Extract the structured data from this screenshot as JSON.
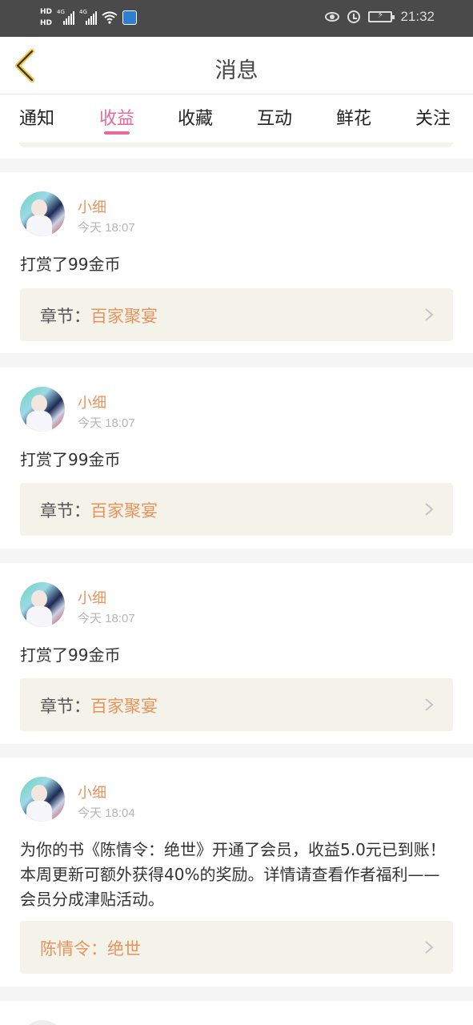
{
  "status_bar": {
    "left_hd1": "HD",
    "left_hd2": "HD",
    "net1": "4G",
    "net2": "4G",
    "time": "21:32",
    "icons": [
      "hd-icon",
      "signal-icon",
      "wifi-icon",
      "app-icon",
      "eye-icon",
      "alarm-icon",
      "battery-icon"
    ]
  },
  "header": {
    "title": "消息",
    "back_icon": "back-chevron-icon"
  },
  "tabs": [
    {
      "label": "通知"
    },
    {
      "label": "收益",
      "active": true
    },
    {
      "label": "收藏"
    },
    {
      "label": "互动"
    },
    {
      "label": "鲜花"
    },
    {
      "label": "关注"
    }
  ],
  "messages": [
    {
      "user": "小细",
      "time": "今天 18:07",
      "text": "打赏了99金币",
      "link_label": "章节：",
      "link_value": "百家聚宴"
    },
    {
      "user": "小细",
      "time": "今天 18:07",
      "text": "打赏了99金币",
      "link_label": "章节：",
      "link_value": "百家聚宴"
    },
    {
      "user": "小细",
      "time": "今天 18:07",
      "text": "打赏了99金币",
      "link_label": "章节：",
      "link_value": "百家聚宴"
    },
    {
      "user": "小细",
      "time": "今天 18:04",
      "text": "为你的书《陈情令：绝世》开通了会员，收益5.0元已到账！本周更新可额外获得40%的奖励。详情请查看作者福利——会员分成津贴活动。",
      "link_label": "",
      "link_value": "陈情令：绝世"
    }
  ],
  "colors": {
    "accent_pink": "#e86a9b",
    "accent_orange": "#e8935c",
    "status_bar": "#4a4a4a",
    "link_box": "#f4f3ea"
  }
}
